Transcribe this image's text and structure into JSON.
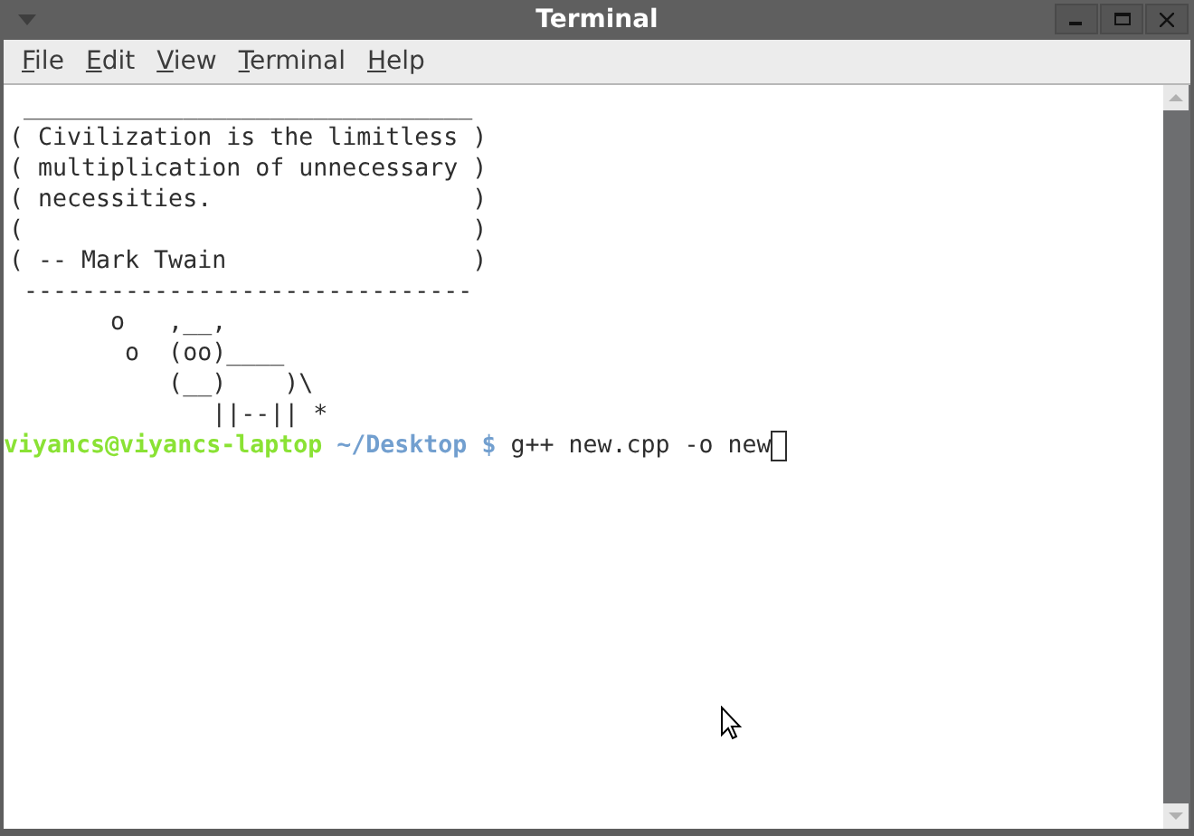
{
  "window": {
    "title": "Terminal"
  },
  "menu": [
    {
      "label": "File"
    },
    {
      "label": "Edit"
    },
    {
      "label": "View"
    },
    {
      "label": "Terminal"
    },
    {
      "label": "Help"
    }
  ],
  "output_lines": [
    " _______________________________",
    "( Civilization is the limitless )",
    "( multiplication of unnecessary )",
    "( necessities.                  )",
    "(                               )",
    "( -- Mark Twain                 )",
    " -------------------------------",
    "       o   ,__,",
    "        o  (oo)____",
    "           (__)    )\\",
    "              ||--|| *"
  ],
  "prompt": {
    "user_host": "viyancs@viyancs-laptop",
    "path": "~/Desktop $",
    "command": "g++ new.cpp -o new"
  }
}
